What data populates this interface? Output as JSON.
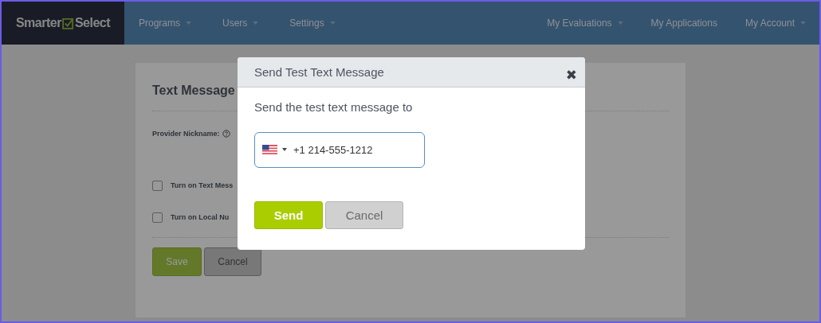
{
  "navbar": {
    "logo": {
      "left": "Smarter",
      "right": "Select"
    },
    "menu_left": [
      {
        "label": "Programs",
        "dropdown": true
      },
      {
        "label": "Users",
        "dropdown": true
      },
      {
        "label": "Settings",
        "dropdown": true
      }
    ],
    "menu_right": [
      {
        "label": "My Evaluations",
        "dropdown": true
      },
      {
        "label": "My Applications",
        "dropdown": false
      },
      {
        "label": "My Account",
        "dropdown": true
      }
    ]
  },
  "settings_card": {
    "title": "Text Message",
    "provider_label": "Provider Nickname:",
    "options": [
      {
        "label": "Turn on Text Mess",
        "checked": false
      },
      {
        "label": "Turn on Local Nu",
        "checked": false
      }
    ],
    "buttons": [
      {
        "label": "Save",
        "kind": "primary"
      },
      {
        "label": "Cancel",
        "kind": "secondary"
      }
    ]
  },
  "dialog": {
    "title": "Send Test Text Message",
    "close": "✖",
    "prompt": "Send the test text message to",
    "phone_field": {
      "value": "+1 214-555-1212"
    },
    "buttons": [
      {
        "label": "Send",
        "kind": "primary"
      },
      {
        "label": "Cancel",
        "kind": "secondary"
      }
    ]
  }
}
